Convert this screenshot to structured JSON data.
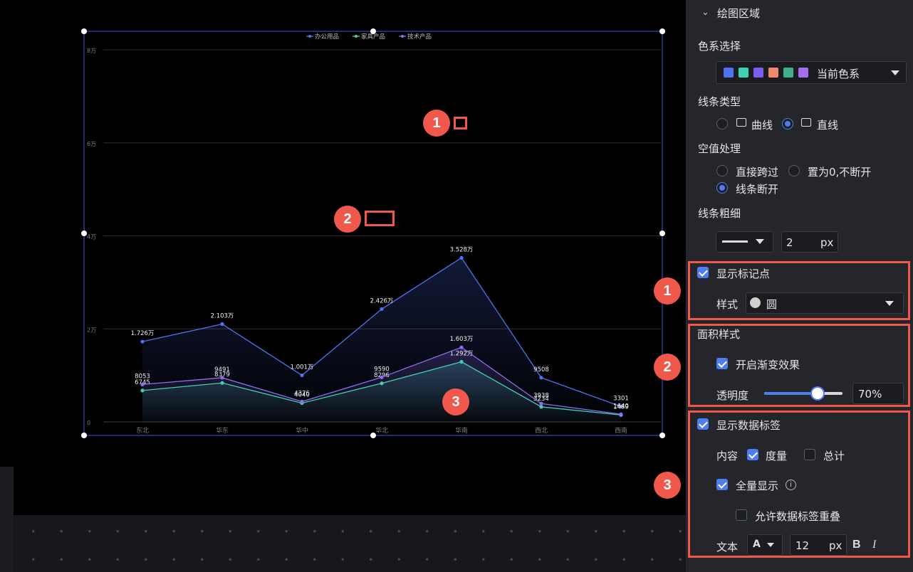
{
  "chart": {
    "legend": [
      "办公用品",
      "家具产品",
      "技术产品"
    ],
    "y_ticks": [
      "8万",
      "6万",
      "4万",
      "2万",
      "0"
    ],
    "x_ticks": [
      "东北",
      "华东",
      "华中",
      "华北",
      "华南",
      "西北",
      "西南"
    ]
  },
  "chart_data": {
    "type": "area",
    "categories": [
      "东北",
      "华东",
      "华中",
      "华北",
      "华南",
      "西北",
      "西南"
    ],
    "ylim": [
      0,
      80000
    ],
    "grid": true,
    "legend_position": "top-center",
    "series": [
      {
        "name": "办公用品",
        "color": "#4f72f0",
        "values": [
          17260,
          21030,
          10010,
          24260,
          35280,
          9508,
          3301
        ],
        "labels": [
          "1.726万",
          "2.103万",
          "1.001万",
          "2.426万",
          "3.528万",
          "9508",
          "3301"
        ]
      },
      {
        "name": "家具产品",
        "color": "#3fd1b6",
        "values": [
          6745,
          8379,
          4040,
          8296,
          12920,
          3234,
          1489
        ],
        "labels": [
          "6745",
          "8379",
          "4040",
          "8296",
          "1.292万",
          "3234",
          "1489"
        ]
      },
      {
        "name": "技术产品",
        "color": "#8f6cf0",
        "values": [
          8053,
          9491,
          4376,
          9590,
          16030,
          3938,
          1640
        ],
        "labels": [
          "8053",
          "9491",
          "4376",
          "9590",
          "1.603万",
          "3938",
          "1640"
        ]
      }
    ]
  },
  "annotations": {
    "badge1": "1",
    "badge2": "2",
    "badge3": "3"
  },
  "panel": {
    "section_title": "绘图区域",
    "color_scheme_label": "色系选择",
    "color_scheme_value": "当前色系",
    "swatches": [
      "#4f72f0",
      "#3fd1b6",
      "#7b5ef0",
      "#f08a6a",
      "#3fae8a",
      "#a46ef0"
    ],
    "line_type_label": "线条类型",
    "line_type_curve": "曲线",
    "line_type_straight": "直线",
    "null_label": "空值处理",
    "null_skip": "直接跨过",
    "null_zero": "置为0,不断开",
    "null_break": "线条断开",
    "line_width_label": "线条粗细",
    "line_width_value": "2",
    "px": "px",
    "show_marker": "显示标记点",
    "marker_style_label": "样式",
    "marker_style_value": "圆",
    "area_style_title": "面积样式",
    "gradient_label": "开启渐变效果",
    "opacity_label": "透明度",
    "opacity_value": "70%",
    "opacity_fraction": 0.7,
    "show_data_label": "显示数据标签",
    "content_label": "内容",
    "content_measure": "度量",
    "content_total": "总计",
    "show_all": "全量显示",
    "allow_overlap": "允许数据标签重叠",
    "text_label": "文本",
    "font_glyph": "A",
    "font_size": "12",
    "bold_glyph": "B",
    "italic_glyph": "I"
  }
}
